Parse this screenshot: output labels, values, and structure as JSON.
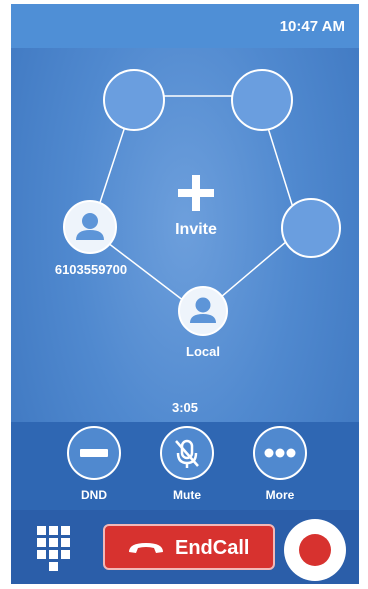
{
  "status_bar": {
    "time": "10:47 AM"
  },
  "conference": {
    "invite_label": "Invite",
    "participants": [
      {
        "label": "6103559700",
        "icon": "person-avatar-icon"
      },
      {
        "label": "Local",
        "icon": "person-avatar-icon"
      }
    ],
    "empty_slots": 3
  },
  "call": {
    "duration": "3:05"
  },
  "controls": {
    "dnd_label": "DND",
    "mute_label": "Mute",
    "more_label": "More"
  },
  "bottom": {
    "endcall_label": "EndCall",
    "dialpad_icon": "dialpad-icon",
    "record_icon": "record-icon"
  },
  "colors": {
    "background": "#5089cf",
    "endcall": "#d7322f",
    "record": "#d7322f"
  }
}
